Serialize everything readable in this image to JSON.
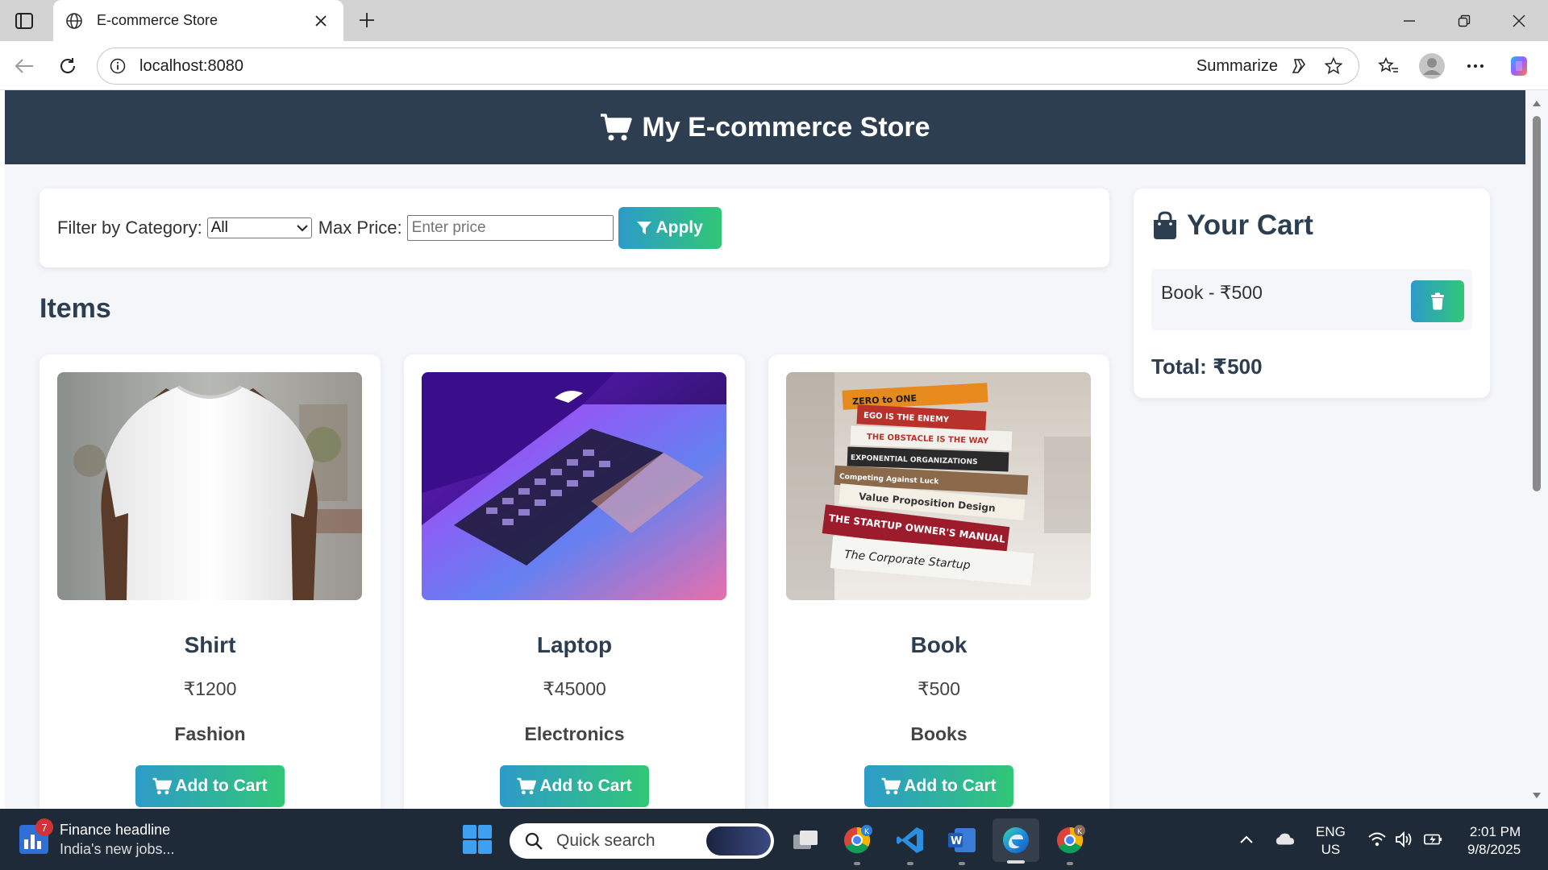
{
  "browser": {
    "tab_title": "E-commerce Store",
    "url": "localhost:8080",
    "summarize_label": "Summarize"
  },
  "site": {
    "title": "My E-commerce Store"
  },
  "filter": {
    "category_label": "Filter by Category:",
    "category_selected": "All",
    "price_label": "Max Price:",
    "price_placeholder": "Enter price",
    "apply_label": "Apply"
  },
  "items_heading": "Items",
  "products": [
    {
      "name": "Shirt",
      "price": "₹1200",
      "category": "Fashion",
      "button": "Add to Cart"
    },
    {
      "name": "Laptop",
      "price": "₹45000",
      "category": "Electronics",
      "button": "Add to Cart"
    },
    {
      "name": "Book",
      "price": "₹500",
      "category": "Books",
      "button": "Add to Cart"
    }
  ],
  "book_spines": [
    "ZERO to ONE",
    "EGO IS THE ENEMY",
    "THE OBSTACLE IS THE WAY",
    "EXPONENTIAL ORGANIZATIONS",
    "Competing Against Luck",
    "Value Proposition Design",
    "THE STARTUP OWNER'S MANUAL",
    "The Corporate Startup"
  ],
  "cart": {
    "heading": "Your Cart",
    "items": [
      {
        "label": "Book - ₹500"
      }
    ],
    "total": "Total: ₹500"
  },
  "taskbar": {
    "news_badge": "7",
    "news_title": "Finance headline",
    "news_sub": "India's new jobs...",
    "search_placeholder": "Quick search",
    "lang_top": "ENG",
    "lang_bottom": "US",
    "time": "2:01 PM",
    "date": "9/8/2025"
  },
  "colors": {
    "header_bg": "#2c3e50",
    "page_bg": "#f5f6fa",
    "button_gradient_start": "#2d9bc9",
    "button_gradient_end": "#31c777"
  }
}
